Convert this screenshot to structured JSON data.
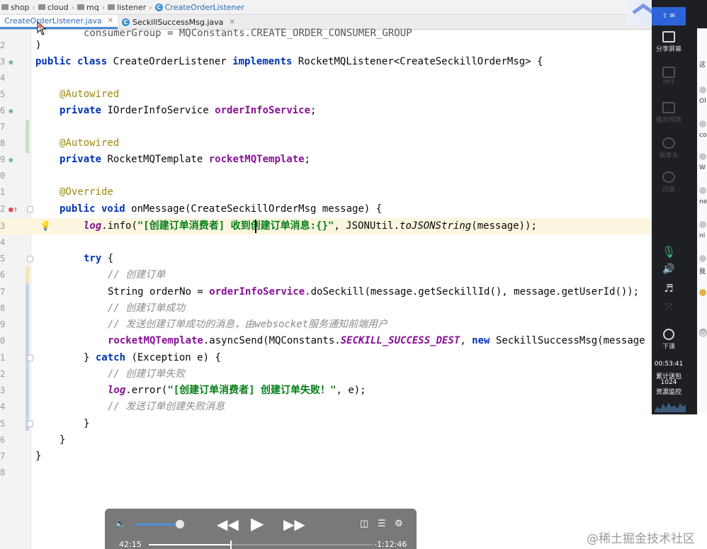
{
  "breadcrumb": [
    "shop",
    "cloud",
    "mq",
    "listener",
    "CreateOrderListener"
  ],
  "tabs": [
    {
      "label": "CreateOrderListener.java",
      "active": true
    },
    {
      "label": "SeckillSuccessMsg.java",
      "active": false
    }
  ],
  "code": {
    "line_numbers": [
      "",
      "2",
      "3",
      "4",
      "5",
      "6",
      "7",
      "8",
      "9",
      "0",
      "1",
      "2",
      "3",
      "4",
      "5",
      "6",
      "7",
      "8",
      "9",
      "0",
      "1",
      "2",
      "3",
      "4",
      "5",
      "6",
      "7",
      "8"
    ],
    "l01": "consumerGroup = MQConstants.CREATE_ORDER_CONSUMER_GROUP",
    "l02": ")",
    "l03a": "public class",
    "l03b": " CreateOrderListener ",
    "l03c": "implements",
    "l03d": " RocketMQListener<CreateSeckillOrderMsg> {",
    "l05": "@Autowired",
    "l06a": "private",
    "l06b": " IOrderInfoService ",
    "l06c": "orderInfoService",
    "l06d": ";",
    "l08": "@Autowired",
    "l09a": "private",
    "l09b": " RocketMQTemplate ",
    "l09c": "rocketMQTemplate",
    "l09d": ";",
    "l11": "@Override",
    "l12a": "public void",
    "l12b": " onMessage(CreateSeckillOrderMsg message) {",
    "l13a": "log",
    "l13b": ".info(",
    "l13c": "\"[创建订单消费者] 收到创建订单消息:{}\"",
    "l13d": ", JSONUtil.",
    "l13e": "toJSONString",
    "l13f": "(message));",
    "l15a": "try",
    "l15b": " {",
    "l16": "// 创建订单",
    "l17a": "String orderNo = ",
    "l17b": "orderInfoService",
    "l17c": ".doSeckill(message.getSeckillId(), message.getUserId());",
    "l18": "// 创建订单成功",
    "l19": "// 发送创建订单成功的消息，由websocket服务通知前端用户",
    "l20a": "rocketMQTemplate",
    "l20b": ".asyncSend(MQConstants.",
    "l20c": "SECKILL_SUCCESS_DEST",
    "l20d": ", ",
    "l20e": "new",
    "l20f": " SeckillSuccessMsg(message",
    "l21a": "} ",
    "l21b": "catch",
    "l21c": " (Exception e) {",
    "l22": "// 创建订单失败",
    "l23a": "log",
    "l23b": ".error(",
    "l23c": "\"[创建订单消费者] 创建订单失败！\"",
    "l23d": ", e);",
    "l24": "// 发送订单创建失败消息",
    "l25": "}",
    "l26": "}",
    "l27": "}"
  },
  "side_panel": {
    "share_label": "分享屏幕",
    "ppt_label": "PPT",
    "video_label": "播放视频",
    "camera_label": "摄像头",
    "whiteboard_label": "白板",
    "end_label": "下课",
    "elapsed": "00:53:41",
    "gift_label": "累计送包",
    "gift_count": "1024",
    "resource_label": "资源监控"
  },
  "chat_snippets": [
    "这",
    "Ol",
    "co",
    "W",
    "ne",
    "ni",
    "我"
  ],
  "player": {
    "current_time": "42:15",
    "remaining_time": "-1:12:46",
    "volume": 0.85,
    "progress": 0.37
  },
  "watermark": "@稀土掘金技术社区",
  "colors": {
    "keyword": "#0033b3",
    "field": "#871094",
    "string": "#067d17",
    "annotation": "#9e880d",
    "comment": "#8c8c8c"
  }
}
